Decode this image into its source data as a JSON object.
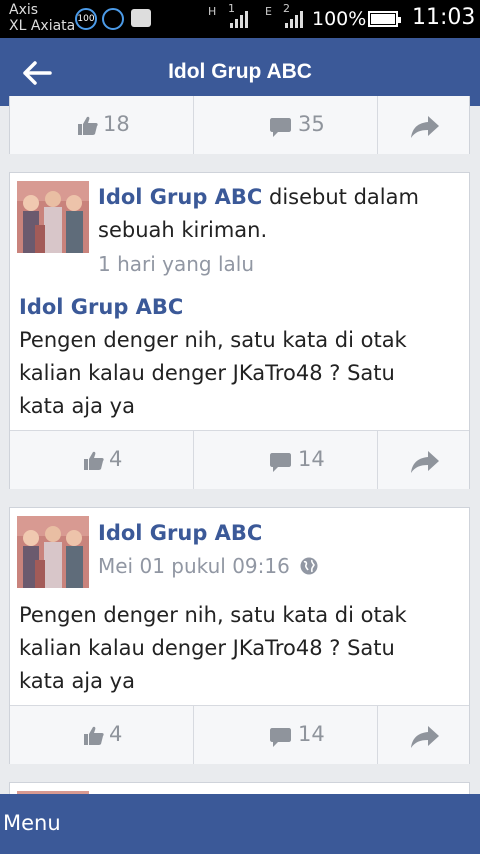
{
  "status_bar": {
    "carrier_line1": "Axis",
    "carrier_line2": "XL Axiata",
    "data_badge": "100",
    "net_h": "H",
    "net_1": "1",
    "net_e": "E",
    "net_2": "2",
    "battery_percent": "100%",
    "time": "11:03"
  },
  "header": {
    "title": "Idol Grup ABC"
  },
  "card1": {
    "likes": "18",
    "comments": "35"
  },
  "card2": {
    "author": "Idol Grup ABC",
    "action_text": " disebut dalam",
    "action_text_2": "sebuah kiriman.",
    "time": "1 hari yang lalu",
    "post_author": "Idol Grup ABC",
    "body": [
      "Pengen denger nih, satu kata di otak",
      "kalian kalau denger JKaTro48 ? Satu",
      "kata aja ya"
    ],
    "likes": "4",
    "comments": "14"
  },
  "card3": {
    "author": "Idol Grup ABC",
    "time": "Mei 01 pukul 09:16",
    "body": [
      "Pengen denger nih, satu kata di otak",
      "kalian kalau denger JKaTro48 ? Satu",
      "kata aja ya"
    ],
    "likes": "4",
    "comments": "14"
  },
  "footer": {
    "menu_label": "Menu"
  },
  "colors": {
    "brand": "#3b5998",
    "status_bar": "#000000",
    "background": "#e9ebee"
  },
  "icons": [
    "back-arrow-icon",
    "like-icon",
    "comment-icon",
    "share-icon",
    "globe-icon"
  ]
}
